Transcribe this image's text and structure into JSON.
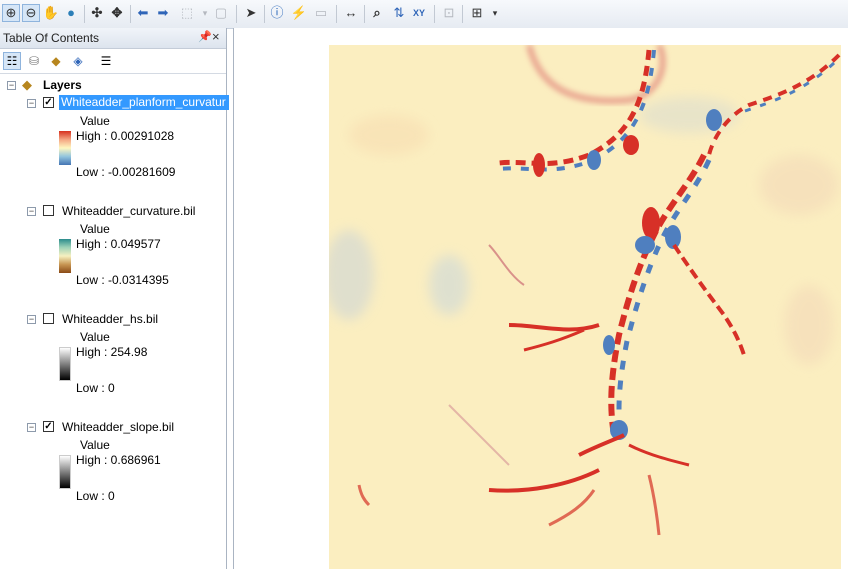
{
  "toolbar": {
    "buttons": [
      {
        "name": "zoom-in-icon",
        "glyph": "⊕"
      },
      {
        "name": "zoom-out-icon",
        "glyph": "⊖",
        "selected": true
      },
      {
        "name": "pan-hand-icon",
        "glyph": "✋"
      },
      {
        "name": "full-extent-globe-icon",
        "glyph": "🌐"
      },
      {
        "name": "fixed-zoom-in-icon",
        "glyph": "⤡"
      },
      {
        "name": "fixed-zoom-out-icon",
        "glyph": "⤢"
      },
      {
        "name": "back-arrow-icon",
        "glyph": "◀"
      },
      {
        "name": "forward-arrow-icon",
        "glyph": "▶"
      },
      {
        "name": "select-features-icon",
        "glyph": "⬚",
        "disabled": true
      },
      {
        "name": "clear-selection-icon",
        "glyph": "▢",
        "disabled": true
      },
      {
        "name": "select-elements-icon",
        "glyph": "➤"
      },
      {
        "name": "identify-icon",
        "glyph": "ⓘ"
      },
      {
        "name": "hyperlink-icon",
        "glyph": "⚡",
        "disabled": true
      },
      {
        "name": "html-popup-icon",
        "glyph": "💬",
        "disabled": true
      },
      {
        "name": "measure-icon",
        "glyph": "↔"
      },
      {
        "name": "find-binoculars-icon",
        "glyph": "🔍"
      },
      {
        "name": "find-route-icon",
        "glyph": "⇅"
      },
      {
        "name": "go-to-xy-icon",
        "glyph": "XY"
      },
      {
        "name": "time-slider-icon",
        "glyph": "⊡",
        "disabled": true
      },
      {
        "name": "magnifier-window-icon",
        "glyph": "⊞"
      }
    ]
  },
  "toc": {
    "title": "Table Of Contents",
    "root_label": "Layers",
    "layers": [
      {
        "name": "Whiteadder_planform_curvature.bil",
        "display_name": "Whiteadder_planform_curvatur",
        "checked": true,
        "selected": true,
        "legend_title": "Value",
        "high": "High : 0.00291028",
        "low": "Low : -0.00281609",
        "ramp": [
          "#d7301f",
          "#f4a582",
          "#fff7c0",
          "#92c5de",
          "#4575b4"
        ]
      },
      {
        "name": "Whiteadder_curvature.bil",
        "display_name": "Whiteadder_curvature.bil",
        "checked": false,
        "selected": false,
        "legend_title": "Value",
        "high": "High : 0.049577",
        "low": "Low : -0.0314395",
        "ramp": [
          "#2b8c8c",
          "#9fd3b8",
          "#f6f0c0",
          "#c79552",
          "#8a4b16"
        ]
      },
      {
        "name": "Whiteadder_hs.bil",
        "display_name": "Whiteadder_hs.bil",
        "checked": false,
        "selected": false,
        "legend_title": "Value",
        "high": "High : 254.98",
        "low": "Low : 0",
        "ramp": [
          "#ffffff",
          "#000000"
        ]
      },
      {
        "name": "Whiteadder_slope.bil",
        "display_name": "Whiteadder_slope.bil",
        "checked": true,
        "selected": false,
        "legend_title": "Value",
        "high": "High : 0.686961",
        "low": "Low : 0",
        "ramp": [
          "#ffffff",
          "#000000"
        ]
      }
    ]
  },
  "map": {
    "background_color": "#fbeec0",
    "positive_color": "#d73027",
    "negative_color": "#4f7fbf"
  }
}
